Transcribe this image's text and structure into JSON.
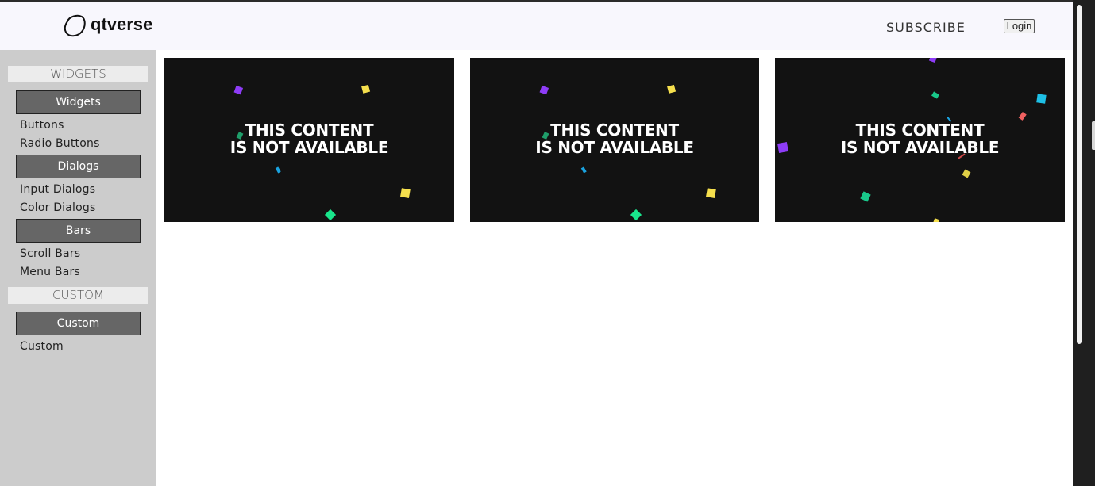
{
  "header": {
    "logo_text": "qtverse",
    "subscribe_label": "SUBSCRIBE",
    "login_label": "Login"
  },
  "sidebar": {
    "sections": [
      {
        "heading": "WIDGETS",
        "groups": [
          {
            "button": "Widgets",
            "links": [
              "Buttons",
              "Radio Buttons"
            ]
          },
          {
            "button": "Dialogs",
            "links": [
              "Input Dialogs",
              "Color Dialogs"
            ]
          },
          {
            "button": "Bars",
            "links": [
              "Scroll Bars",
              "Menu Bars"
            ]
          }
        ]
      },
      {
        "heading": "CUSTOM",
        "groups": [
          {
            "button": "Custom",
            "links": [
              "Custom"
            ]
          }
        ]
      }
    ]
  },
  "content": {
    "cards": [
      {
        "line1": "THIS CONTENT",
        "line2": "IS NOT AVAILABLE"
      },
      {
        "line1": "THIS CONTENT",
        "line2": "IS NOT AVAILABLE"
      },
      {
        "line1": "THIS CONTENT",
        "line2": "IS NOT AVAILABLE"
      }
    ]
  },
  "colors": {
    "sidebar_bg": "#cccccc",
    "category_button_bg": "#666666",
    "card_bg": "#121212",
    "confetti_purple": "#8e3cf7",
    "confetti_yellow": "#f5df4d",
    "confetti_green": "#19e68c",
    "confetti_blue": "#1aa3e0",
    "confetti_red": "#f06060"
  }
}
